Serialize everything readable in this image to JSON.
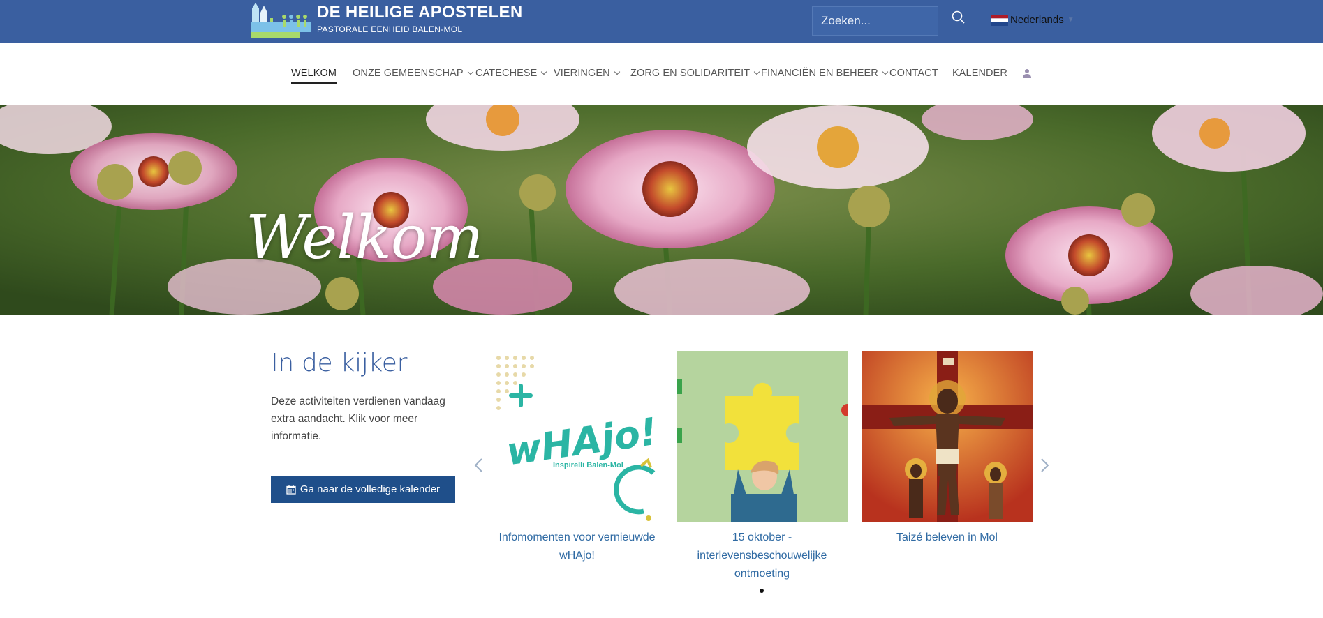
{
  "header": {
    "title": "DE HEILIGE APOSTELEN",
    "subtitle": "PASTORALE EENHEID BALEN-MOL",
    "search_placeholder": "Zoeken...",
    "language": "Nederlands"
  },
  "nav": {
    "items": [
      {
        "label": "WELKOM",
        "dropdown": false,
        "active": true
      },
      {
        "label": "ONZE GEMEENSCHAP",
        "dropdown": true
      },
      {
        "label": "CATECHESE",
        "dropdown": true
      },
      {
        "label": "VIERINGEN",
        "dropdown": true
      },
      {
        "label": "ZORG EN SOLIDARITEIT",
        "dropdown": true
      },
      {
        "label": "FINANCIËN EN BEHEER",
        "dropdown": true
      },
      {
        "label": "CONTACT",
        "dropdown": false
      },
      {
        "label": "KALENDER",
        "dropdown": false
      }
    ]
  },
  "hero": {
    "title": "Welkom"
  },
  "featured": {
    "title": "In de kijker",
    "description": "Deze activiteiten verdienen vandaag extra aandacht. Klik voor meer informatie.",
    "button_label": "Ga naar de volledige kalender",
    "cards": [
      {
        "caption": "Infomomenten voor vernieuwde wHAjo!",
        "image_text": "wHAjo!",
        "image_subtext": "Inspirelli Balen-Mol"
      },
      {
        "caption": "15 oktober - interlevensbeschouwelijke ontmoeting"
      },
      {
        "caption": "Taizé beleven in Mol"
      }
    ]
  },
  "colors": {
    "header_bg": "#3a5fa0",
    "accent": "#3a5fa0",
    "button_bg": "#1f4f8a",
    "link": "#2f6aa3"
  }
}
